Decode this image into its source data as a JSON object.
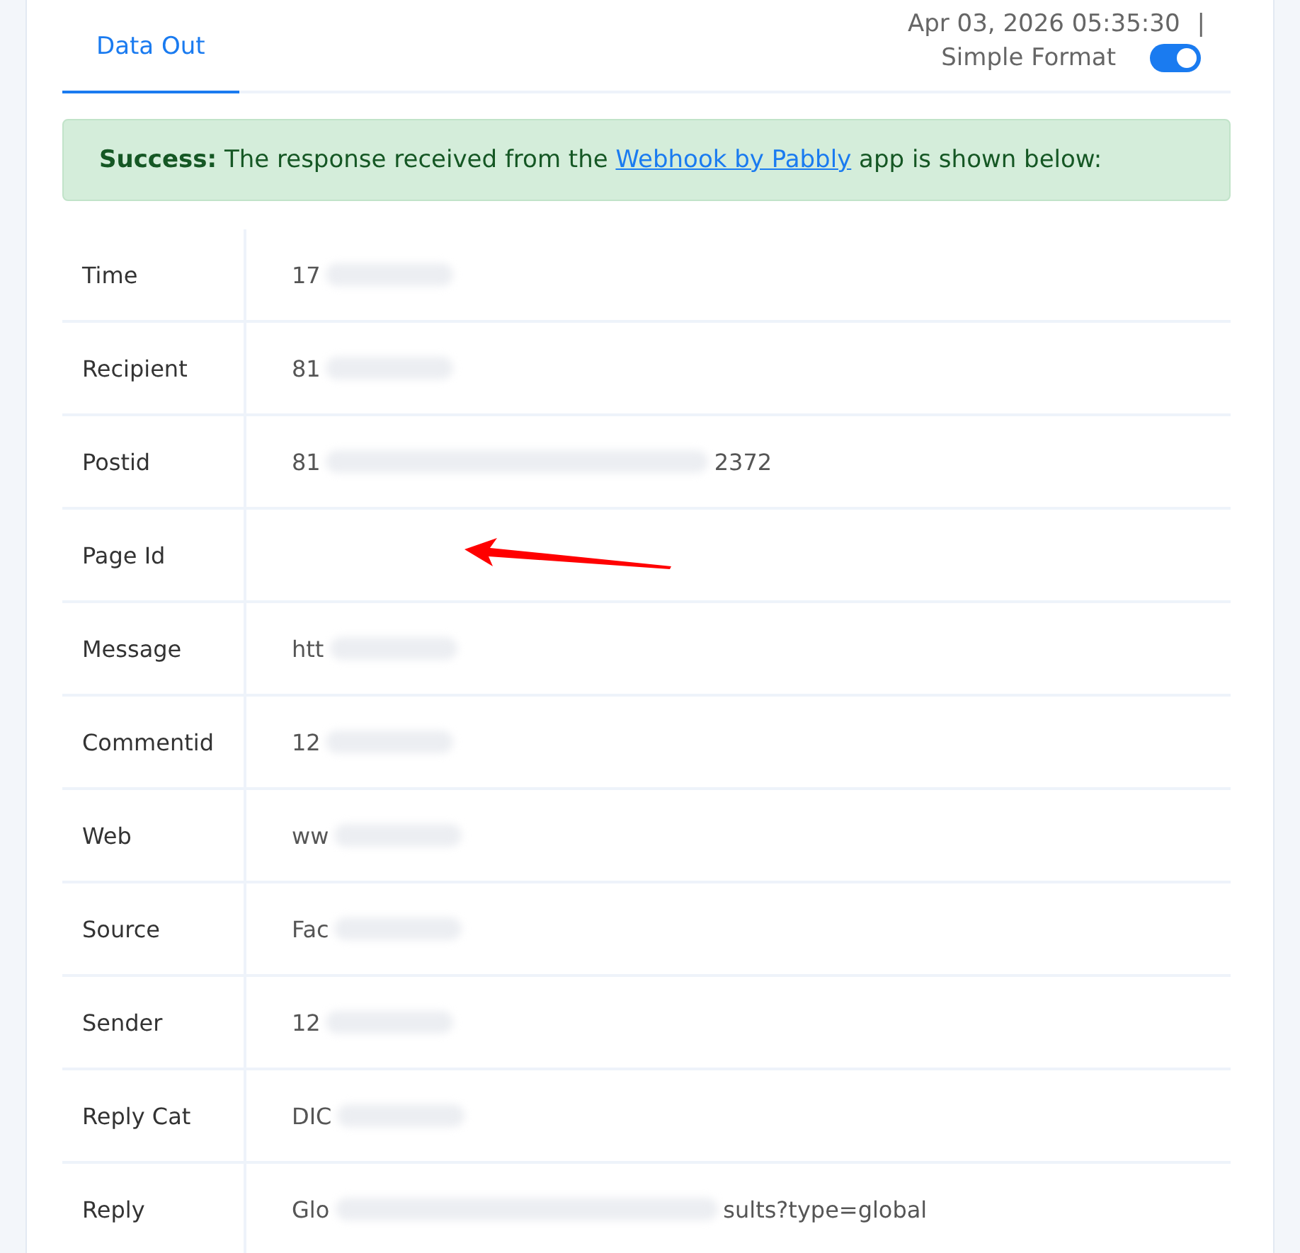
{
  "tabs": [
    {
      "label": "Data Out",
      "selected": true
    }
  ],
  "header": {
    "timestamp": "Apr 03, 2026 05:35:30",
    "separator": "|",
    "toggle": {
      "label": "Simple Format",
      "on": true
    }
  },
  "alert": {
    "kind": "success",
    "text": "**Success:** The response received from the",
    "link": "Webhook by Pabbly",
    "text_after": "app is shown below:"
  },
  "rows": [
    {
      "label": "Time",
      "value_head": "17",
      "redacted": true
    },
    {
      "label": "Recipient",
      "value_head": "81",
      "redacted": true
    },
    {
      "label": "Postid",
      "value_head": "81",
      "redacted": true,
      "value_tail": "2372"
    },
    {
      "label": "Page Id",
      "redacted": false,
      "arrow": true
    },
    {
      "label": "Message",
      "value_head": "htt",
      "redacted": true
    },
    {
      "label": "Commentid",
      "value_head": "12",
      "redacted": true
    },
    {
      "label": "Web",
      "value_head": "ww",
      "redacted": true
    },
    {
      "label": "Source",
      "value_head": "Fac",
      "redacted": true
    },
    {
      "label": "Sender",
      "value_head": "12",
      "redacted": true
    },
    {
      "label": "Reply Cat",
      "value_head": "DIC",
      "redacted": true
    },
    {
      "label": "Reply",
      "value_head": "Glo",
      "redacted": true,
      "value_tail": "sults?type=global"
    }
  ]
}
